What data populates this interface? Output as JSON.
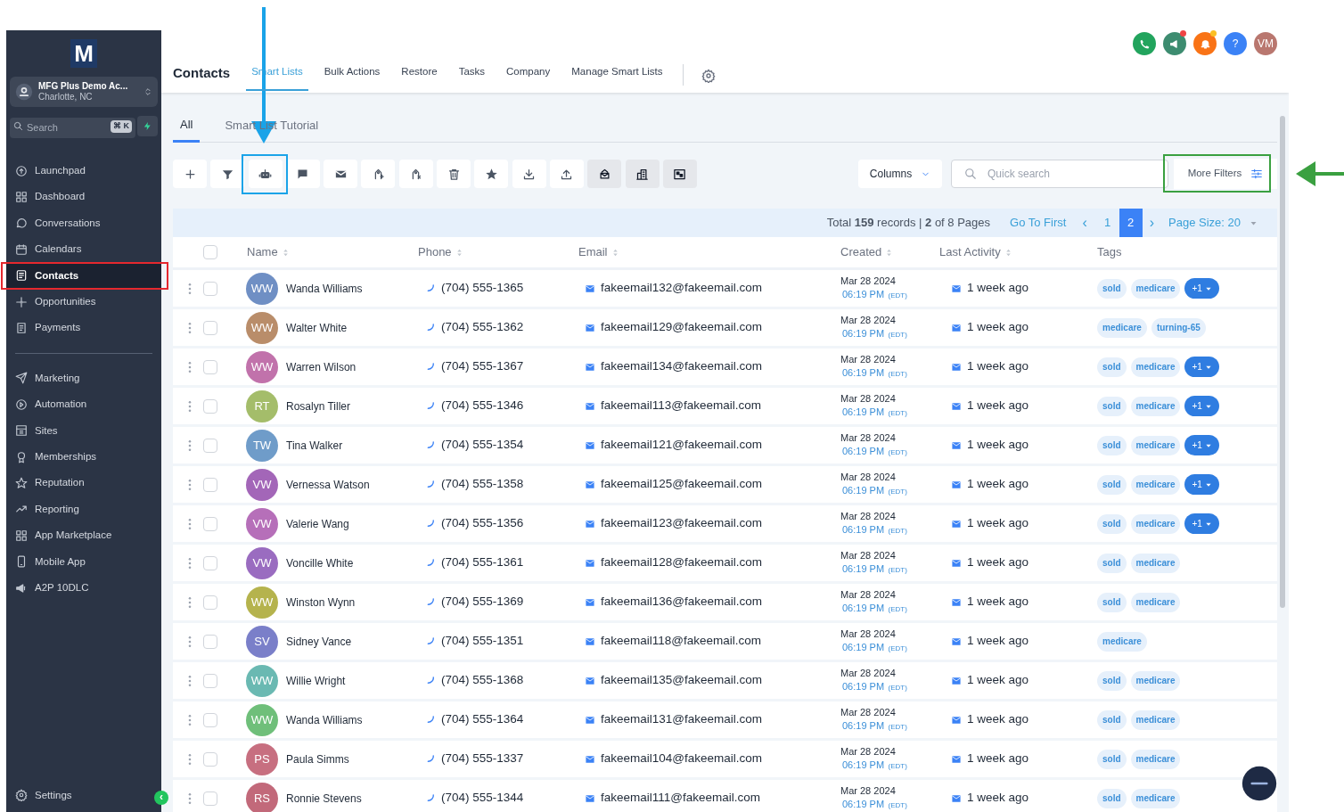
{
  "sidebar": {
    "logo": "M",
    "account": {
      "name": "MFG Plus Demo Ac...",
      "location": "Charlotte, NC"
    },
    "search": {
      "placeholder": "Search",
      "shortcut": "⌘ K"
    },
    "items": [
      {
        "label": "Launchpad",
        "selected": false,
        "section_start": false
      },
      {
        "label": "Dashboard",
        "selected": false,
        "section_start": false
      },
      {
        "label": "Conversations",
        "selected": false,
        "section_start": false
      },
      {
        "label": "Calendars",
        "selected": false,
        "section_start": false
      },
      {
        "label": "Contacts",
        "selected": true,
        "section_start": false
      },
      {
        "label": "Opportunities",
        "selected": false,
        "section_start": false
      },
      {
        "label": "Payments",
        "selected": false,
        "section_start": false
      },
      {
        "label": "Marketing",
        "selected": false,
        "section_start": true
      },
      {
        "label": "Automation",
        "selected": false,
        "section_start": false
      },
      {
        "label": "Sites",
        "selected": false,
        "section_start": false
      },
      {
        "label": "Memberships",
        "selected": false,
        "section_start": false
      },
      {
        "label": "Reputation",
        "selected": false,
        "section_start": false
      },
      {
        "label": "Reporting",
        "selected": false,
        "section_start": false
      },
      {
        "label": "App Marketplace",
        "selected": false,
        "section_start": false
      },
      {
        "label": "Mobile App",
        "selected": false,
        "section_start": false
      },
      {
        "label": "A2P 10DLC",
        "selected": false,
        "section_start": false
      }
    ],
    "settings": "Settings",
    "collapse": "‹"
  },
  "header": {
    "title": "Contacts",
    "tabs": [
      {
        "label": "Smart Lists",
        "selected": true
      },
      {
        "label": "Bulk Actions",
        "selected": false
      },
      {
        "label": "Restore",
        "selected": false
      },
      {
        "label": "Tasks",
        "selected": false
      },
      {
        "label": "Company",
        "selected": false
      },
      {
        "label": "Manage Smart Lists",
        "selected": false
      }
    ],
    "help": "?",
    "user_initials": "VM"
  },
  "subtabs": [
    {
      "label": "All",
      "selected": true
    },
    {
      "label": "Smart List Tutorial",
      "selected": false
    }
  ],
  "toolbar_buttons": [
    {
      "shaded": false
    },
    {
      "shaded": false
    },
    {
      "shaded": false
    },
    {
      "shaded": false
    },
    {
      "shaded": false
    },
    {
      "shaded": false
    },
    {
      "shaded": false
    },
    {
      "shaded": false
    },
    {
      "shaded": false
    },
    {
      "shaded": false
    },
    {
      "shaded": false
    },
    {
      "shaded": true
    },
    {
      "shaded": true
    },
    {
      "shaded": true
    }
  ],
  "columns_button": "Columns",
  "quick_search": {
    "placeholder": "Quick search"
  },
  "more_filters": "More Filters",
  "pagination": {
    "summary": "Total **159** records | **2** of 8 Pages",
    "go_to_first": "Go To First",
    "prev": "‹",
    "pages": [
      {
        "label": "1",
        "selected": false
      },
      {
        "label": "2",
        "selected": true
      }
    ],
    "next": "›",
    "page_size": "Page Size: 20"
  },
  "table": {
    "select_all": {
      "checked": false
    },
    "columns": [
      "Name",
      "Phone",
      "Email",
      "Created",
      "Last Activity",
      "Tags"
    ],
    "rows": [
      {
        "initials": "WW",
        "checked": false,
        "color": "#6f8fc4",
        "name": "Wanda Williams",
        "phone": "(704) 555-1365",
        "email": "fakeemail132@fakeemail.com",
        "date": "Mar 28 2024",
        "time": "06:19 PM",
        "tz": "(EDT)",
        "activity": "1 week ago",
        "tags": [
          "sold",
          "medicare"
        ],
        "more": "+1"
      },
      {
        "initials": "WW",
        "checked": false,
        "color": "#b98d6a",
        "name": "Walter White",
        "phone": "(704) 555-1362",
        "email": "fakeemail129@fakeemail.com",
        "date": "Mar 28 2024",
        "time": "06:19 PM",
        "tz": "(EDT)",
        "activity": "1 week ago",
        "tags": [
          "medicare",
          "turning-65"
        ]
      },
      {
        "initials": "WW",
        "checked": false,
        "color": "#c172ab",
        "name": "Warren Wilson",
        "phone": "(704) 555-1367",
        "email": "fakeemail134@fakeemail.com",
        "date": "Mar 28 2024",
        "time": "06:19 PM",
        "tz": "(EDT)",
        "activity": "1 week ago",
        "tags": [
          "sold",
          "medicare"
        ],
        "more": "+1"
      },
      {
        "initials": "RT",
        "checked": false,
        "color": "#a4bd6a",
        "name": "Rosalyn Tiller",
        "phone": "(704) 555-1346",
        "email": "fakeemail113@fakeemail.com",
        "date": "Mar 28 2024",
        "time": "06:19 PM",
        "tz": "(EDT)",
        "activity": "1 week ago",
        "tags": [
          "sold",
          "medicare"
        ],
        "more": "+1"
      },
      {
        "initials": "TW",
        "checked": false,
        "color": "#6f9cc9",
        "name": "Tina Walker",
        "phone": "(704) 555-1354",
        "email": "fakeemail121@fakeemail.com",
        "date": "Mar 28 2024",
        "time": "06:19 PM",
        "tz": "(EDT)",
        "activity": "1 week ago",
        "tags": [
          "sold",
          "medicare"
        ],
        "more": "+1"
      },
      {
        "initials": "VW",
        "checked": false,
        "color": "#a366b8",
        "name": "Vernessa Watson",
        "phone": "(704) 555-1358",
        "email": "fakeemail125@fakeemail.com",
        "date": "Mar 28 2024",
        "time": "06:19 PM",
        "tz": "(EDT)",
        "activity": "1 week ago",
        "tags": [
          "sold",
          "medicare"
        ],
        "more": "+1"
      },
      {
        "initials": "VW",
        "checked": false,
        "color": "#b66fb9",
        "name": "Valerie Wang",
        "phone": "(704) 555-1356",
        "email": "fakeemail123@fakeemail.com",
        "date": "Mar 28 2024",
        "time": "06:19 PM",
        "tz": "(EDT)",
        "activity": "1 week ago",
        "tags": [
          "sold",
          "medicare"
        ],
        "more": "+1"
      },
      {
        "initials": "VW",
        "checked": false,
        "color": "#9a6cc0",
        "name": "Voncille White",
        "phone": "(704) 555-1361",
        "email": "fakeemail128@fakeemail.com",
        "date": "Mar 28 2024",
        "time": "06:19 PM",
        "tz": "(EDT)",
        "activity": "1 week ago",
        "tags": [
          "sold",
          "medicare"
        ]
      },
      {
        "initials": "WW",
        "checked": false,
        "color": "#b5b34d",
        "name": "Winston Wynn",
        "phone": "(704) 555-1369",
        "email": "fakeemail136@fakeemail.com",
        "date": "Mar 28 2024",
        "time": "06:19 PM",
        "tz": "(EDT)",
        "activity": "1 week ago",
        "tags": [
          "sold",
          "medicare"
        ]
      },
      {
        "initials": "SV",
        "checked": false,
        "color": "#7a7fc9",
        "name": "Sidney Vance",
        "phone": "(704) 555-1351",
        "email": "fakeemail118@fakeemail.com",
        "date": "Mar 28 2024",
        "time": "06:19 PM",
        "tz": "(EDT)",
        "activity": "1 week ago",
        "tags": [
          "medicare"
        ]
      },
      {
        "initials": "WW",
        "checked": false,
        "color": "#6ab9b2",
        "name": "Willie Wright",
        "phone": "(704) 555-1368",
        "email": "fakeemail135@fakeemail.com",
        "date": "Mar 28 2024",
        "time": "06:19 PM",
        "tz": "(EDT)",
        "activity": "1 week ago",
        "tags": [
          "sold",
          "medicare"
        ]
      },
      {
        "initials": "WW",
        "checked": false,
        "color": "#6fbf7a",
        "name": "Wanda Williams",
        "phone": "(704) 555-1364",
        "email": "fakeemail131@fakeemail.com",
        "date": "Mar 28 2024",
        "time": "06:19 PM",
        "tz": "(EDT)",
        "activity": "1 week ago",
        "tags": [
          "sold",
          "medicare"
        ]
      },
      {
        "initials": "PS",
        "checked": false,
        "color": "#c76f80",
        "name": "Paula Simms",
        "phone": "(704) 555-1337",
        "email": "fakeemail104@fakeemail.com",
        "date": "Mar 28 2024",
        "time": "06:19 PM",
        "tz": "(EDT)",
        "activity": "1 week ago",
        "tags": [
          "sold",
          "medicare"
        ]
      },
      {
        "initials": "RS",
        "checked": false,
        "color": "#c2697a",
        "name": "Ronnie Stevens",
        "phone": "(704) 555-1344",
        "email": "fakeemail111@fakeemail.com",
        "date": "Mar 28 2024",
        "time": "06:19 PM",
        "tz": "(EDT)",
        "activity": "1 week ago",
        "tags": [
          "sold",
          "medicare"
        ]
      }
    ]
  }
}
